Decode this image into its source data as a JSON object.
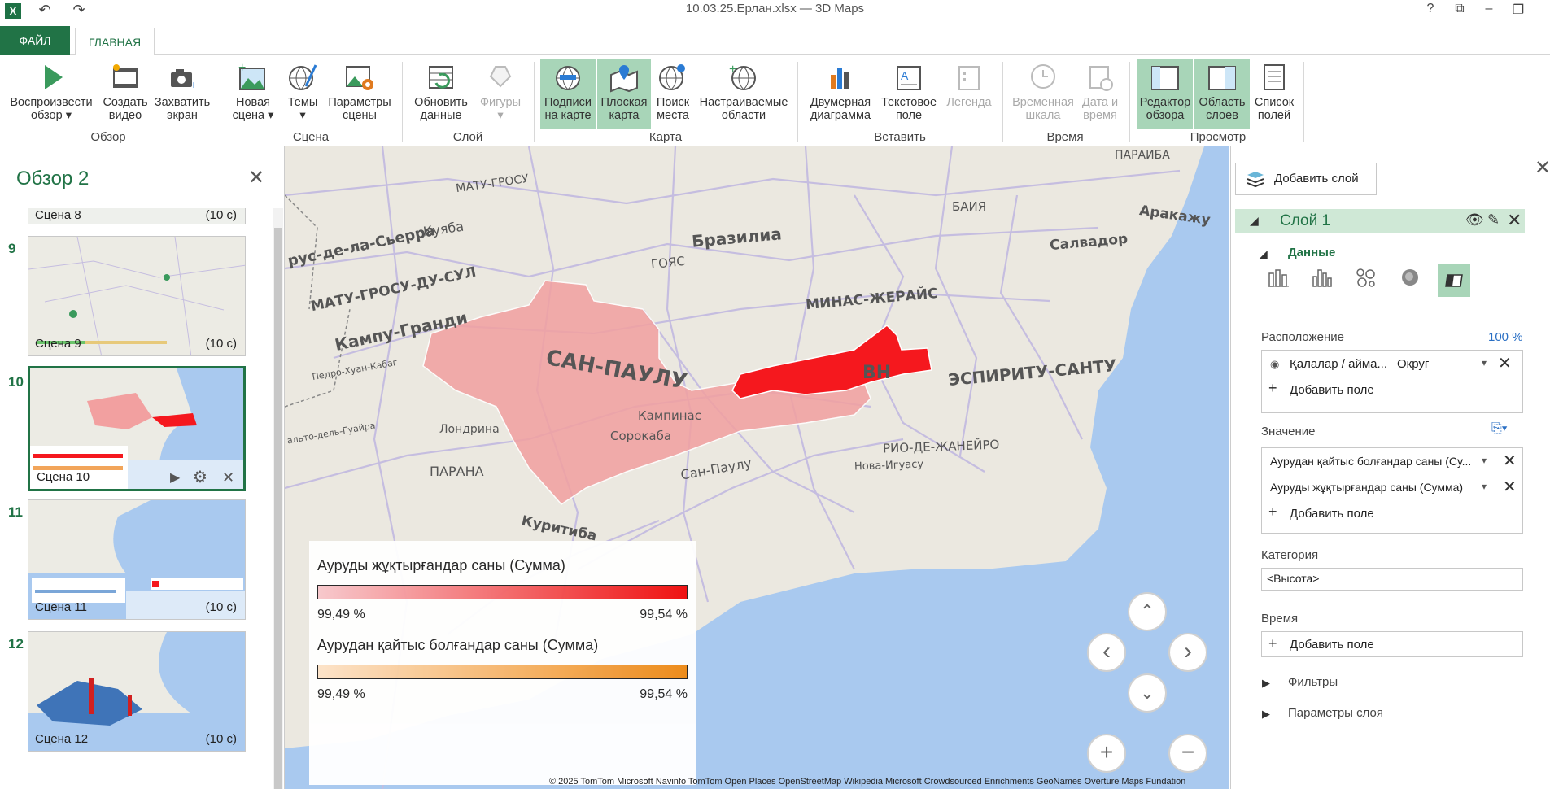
{
  "app": {
    "title": "10.03.25.Ерлан.xlsx — 3D Maps",
    "excel_icon": "X"
  },
  "tabs": {
    "file": "ФАЙЛ",
    "home": "ГЛАВНАЯ"
  },
  "ribbon": {
    "play_tour": "Воспроизвести",
    "play_tour2": "обзор ▾",
    "create_video": "Создать",
    "create_video2": "видео",
    "capture": "Захватить",
    "capture2": "экран",
    "group_tour": "Обзор",
    "new_scene": "Новая",
    "new_scene2": "сцена ▾",
    "themes": "Темы",
    "themes2": "▾",
    "scene_opts": "Параметры",
    "scene_opts2": "сцены",
    "group_scene": "Сцена",
    "refresh": "Обновить",
    "refresh2": "данные",
    "shapes": "Фигуры",
    "shapes2": "▾",
    "group_layer": "Слой",
    "map_labels": "Подписи",
    "map_labels2": "на карте",
    "flat_map": "Плоская",
    "flat_map2": "карта",
    "find_loc": "Поиск",
    "find_loc2": "места",
    "custom_regions": "Настраиваемые",
    "custom_regions2": "области",
    "group_map": "Карта",
    "chart2d": "Двумерная",
    "chart2d2": "диаграмма",
    "textbox": "Текстовое",
    "textbox2": "поле",
    "legend": "Легенда",
    "group_insert": "Вставить",
    "timeline": "Временная",
    "timeline2": "шкала",
    "datetime": "Дата и",
    "datetime2": "время",
    "group_time": "Время",
    "tour_editor": "Редактор",
    "tour_editor2": "обзора",
    "layer_pane": "Область",
    "layer_pane2": "слоев",
    "field_list": "Список",
    "field_list2": "полей",
    "group_view": "Просмотр"
  },
  "tour": {
    "title": "Обзор 2",
    "close": "✕",
    "scenes": [
      {
        "num": "",
        "label": "Сцена 8",
        "dur": "(10 с)"
      },
      {
        "num": "9",
        "label": "Сцена 9",
        "dur": "(10 с)"
      },
      {
        "num": "10",
        "label": "Сцена 10",
        "dur": "(10 с)"
      },
      {
        "num": "11",
        "label": "Сцена 11",
        "dur": "(10 с)"
      },
      {
        "num": "12",
        "label": "Сцена 12",
        "dur": "(10 с)"
      }
    ]
  },
  "map": {
    "labels": [
      "МАТУ-ГРОСУ",
      "Куяба",
      "Бразилиа",
      "ГОЯС",
      "Салвадор",
      "Аракажу",
      "БАИЯ",
      "ПАРАИБА",
      "рус-де-ла-Сьерра",
      "МАТУ-ГРОСУ-ДУ-СУЛ",
      "Кампу-Гранди",
      "МИНАС-ЖЕРАЙС",
      "САН-ПАУЛУ",
      "BH",
      "ЭСПИРИТУ-САНТУ",
      "Педро-Хуан-Кабаг",
      "Кампинас",
      "Лондрина",
      "Сорокаба",
      "РИО-ДЕ-ЖАНЕЙРО",
      "альто-дель-Гуайра",
      "Сан-Паулу",
      "Нова-Игуасу",
      "ПАРАНА",
      "Куритиба"
    ],
    "attribution": "© 2025 TomTom  Microsoft  Navinfo  TomTom  Open Places  OpenStreetMap  Wikipedia  Microsoft Crowdsourced Enrichments  GeoNames  Overture Maps Fundation",
    "colors": {
      "sp": "#f2a0a0",
      "rj": "#f5181e",
      "ocean": "#a9c9ef",
      "land": "#ebe8e0"
    }
  },
  "legend": {
    "s1_title": "Ауруды жұқтырғандар саны (Сумма)",
    "s1_min": "99,49 %",
    "s1_max": "99,54 %",
    "s2_title": "Аурудан қайтыс болғандар саны (Сумма)",
    "s2_min": "99,49 %",
    "s2_max": "99,54 %"
  },
  "nav": {
    "up": "⌃",
    "down": "⌄",
    "left": "‹",
    "right": "›",
    "plus": "+",
    "minus": "−"
  },
  "panel": {
    "add_layer": "Добавить слой",
    "layer_name": "Слой 1",
    "data": "Данные",
    "location": "Расположение",
    "location_pct": "100 %",
    "loc_field": "Қалалар / айма...",
    "loc_type": "Округ",
    "add_field": "Добавить поле",
    "value": "Значение",
    "val1": "Аурудан қайтыс болғандар саны (Су...",
    "val2": "Ауруды жұқтырғандар саны (Сумма)",
    "category": "Категория",
    "category_val": "<Высота>",
    "time": "Время",
    "filters": "Фильтры",
    "layer_opts": "Параметры слоя"
  }
}
